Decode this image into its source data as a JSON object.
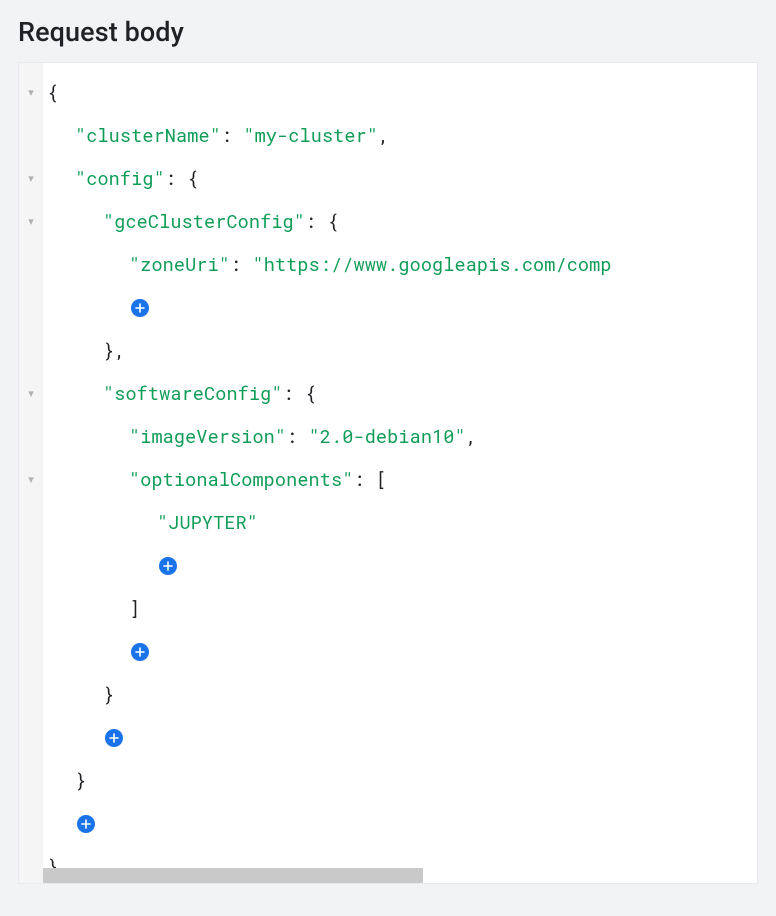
{
  "header": {
    "title": "Request body"
  },
  "icons": {
    "fold": "▾"
  },
  "colors": {
    "accent": "#1a73e8",
    "string": "#0f9d58"
  },
  "json_body": {
    "clusterName": "my-cluster",
    "config": {
      "gceClusterConfig": {
        "zoneUri": "https://www.googleapis.com/comp"
      },
      "softwareConfig": {
        "imageVersion": "2.0-debian10",
        "optionalComponents": [
          "JUPYTER"
        ]
      }
    }
  },
  "tokens": {
    "brace_open": "{",
    "brace_close": "}",
    "brace_close_comma": "},",
    "bracket_open": "[",
    "bracket_close": "]",
    "comma": ",",
    "colon_sp": ": ",
    "q": "\"",
    "k_clusterName": "clusterName",
    "v_clusterName": "my-cluster",
    "k_config": "config",
    "k_gceClusterConfig": "gceClusterConfig",
    "k_zoneUri": "zoneUri",
    "v_zoneUri": "https://www.googleapis.com/comp",
    "k_softwareConfig": "softwareConfig",
    "k_imageVersion": "imageVersion",
    "v_imageVersion": "2.0-debian10",
    "k_optionalComponents": "optionalComponents",
    "v_comp0": "JUPYTER"
  }
}
